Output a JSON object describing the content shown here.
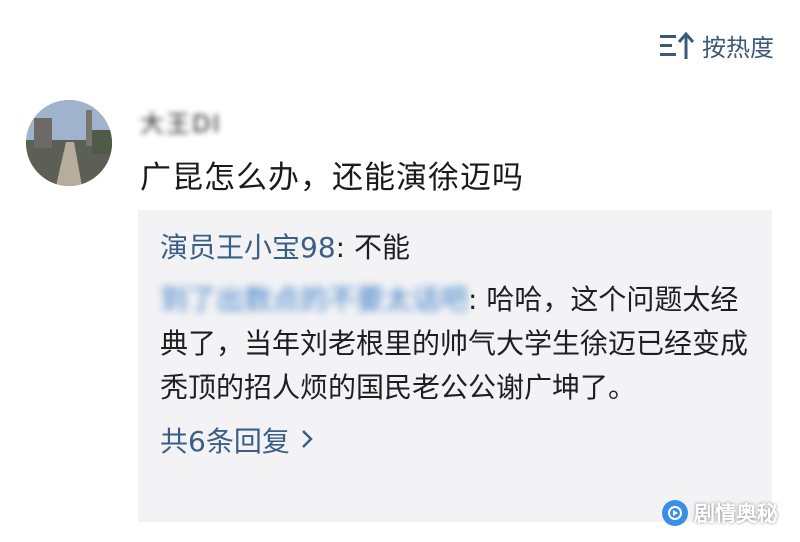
{
  "sort": {
    "label": "按热度",
    "icon": "sort-icon"
  },
  "comment": {
    "avatar_icon": "avatar-photo",
    "username": "大王DI",
    "text": "广昆怎么办，还能演徐迈吗"
  },
  "replies": [
    {
      "author": "演员王小宝98",
      "separator": ": ",
      "text": "不能"
    },
    {
      "author": "到了出数点的不要太话吧",
      "separator": ": ",
      "text": "哈哈，这个问题太经典了，当年刘老根里的帅气大学生徐迈已经变成秃顶的招人烦的国民老公公谢广坤了。"
    }
  ],
  "more_replies": {
    "label": "共6条回复",
    "icon": "chevron-right-icon"
  },
  "watermark": {
    "text": "剧情奥秘",
    "icon": "logo-icon"
  },
  "colors": {
    "link": "#3a5f87",
    "reply_bg": "#f3f3f5"
  }
}
